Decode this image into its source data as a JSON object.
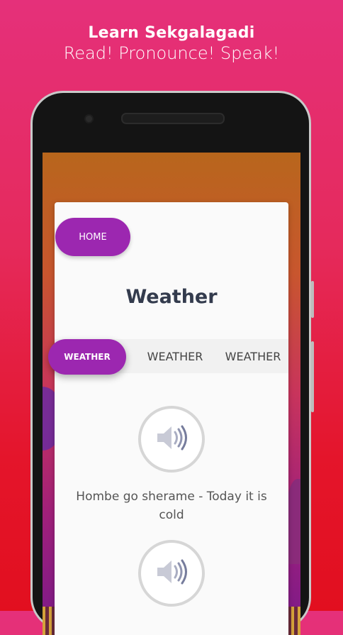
{
  "promo": {
    "title": "Learn Sekgalagadi",
    "subtitle": "Read! Pronounce! Speak!"
  },
  "app": {
    "home_button": "HOME",
    "page_title": "Weather",
    "tabs": [
      {
        "label": "WEATHER",
        "active": true
      },
      {
        "label": "WEATHER",
        "active": false
      },
      {
        "label": "WEATHER",
        "active": false
      }
    ],
    "phrases": [
      {
        "text": "Hombe go sherame - Today it is cold",
        "icon": "speaker-icon"
      },
      {
        "text": "",
        "icon": "speaker-icon"
      }
    ]
  },
  "colors": {
    "accent": "#9c27b0",
    "background_top": "#e5307a",
    "background_bottom": "#e20f1f"
  }
}
